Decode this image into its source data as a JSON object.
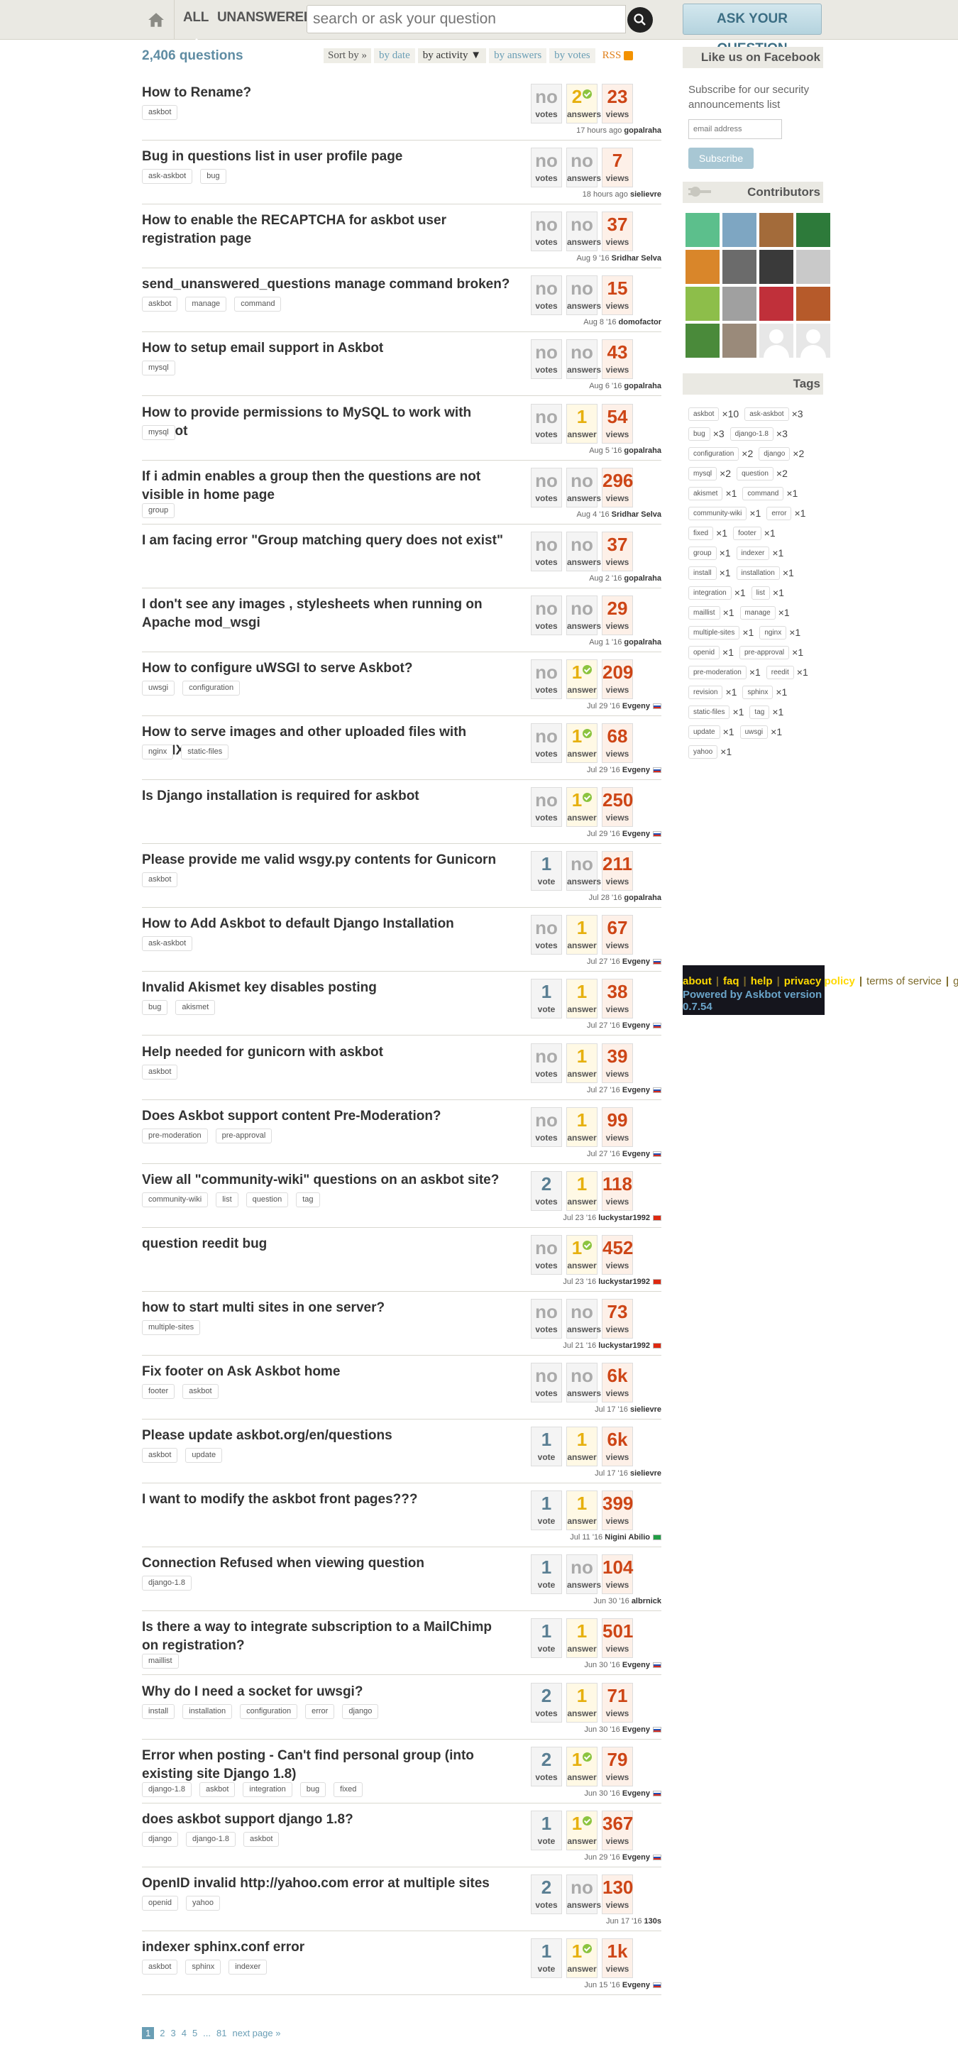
{
  "header": {
    "scope_all": "ALL",
    "scope_unanswered": "UNANSWERED",
    "search_placeholder": "search or ask your question",
    "ask_button": "ASK YOUR QUESTION"
  },
  "main": {
    "question_count": "2,406 questions",
    "sort_label": "Sort by »",
    "sort_tabs": [
      "by date",
      "by activity ▼",
      "by answers",
      "by votes"
    ],
    "rss": "RSS"
  },
  "questions": [
    {
      "title": "How to Rename?",
      "tags": [
        "askbot"
      ],
      "votes": "no",
      "votes_label": "votes",
      "answers": "2",
      "answers_label": "answers",
      "accepted": true,
      "views": "23",
      "views_label": "views",
      "time": "17 hours ago",
      "user": "gopalraha",
      "flag": ""
    },
    {
      "title": "Bug in questions list in user profile page",
      "tags": [
        "ask-askbot",
        "bug"
      ],
      "votes": "no",
      "votes_label": "votes",
      "answers": "no",
      "answers_label": "answers",
      "accepted": false,
      "views": "7",
      "views_label": "views",
      "time": "18 hours ago",
      "user": "sielievre",
      "flag": ""
    },
    {
      "title": "How to enable the RECAPTCHA for askbot user registration page",
      "tags": [],
      "votes": "no",
      "votes_label": "votes",
      "answers": "no",
      "answers_label": "answers",
      "accepted": false,
      "views": "37",
      "views_label": "views",
      "time": "Aug 9 '16",
      "user": "Sridhar Selva",
      "flag": ""
    },
    {
      "title": "send_unanswered_questions manage command broken?",
      "tags": [
        "askbot",
        "manage",
        "command"
      ],
      "votes": "no",
      "votes_label": "votes",
      "answers": "no",
      "answers_label": "answers",
      "accepted": false,
      "views": "15",
      "views_label": "views",
      "time": "Aug 8 '16",
      "user": "domofactor",
      "flag": ""
    },
    {
      "title": "How to setup email support in Askbot",
      "tags": [
        "mysql"
      ],
      "votes": "no",
      "votes_label": "votes",
      "answers": "no",
      "answers_label": "answers",
      "accepted": false,
      "views": "43",
      "views_label": "views",
      "time": "Aug 6 '16",
      "user": "gopalraha",
      "flag": ""
    },
    {
      "title": "How to provide permissions to MySQL to work with Askbot",
      "tags": [
        "mysql"
      ],
      "votes": "no",
      "votes_label": "votes",
      "answers": "1",
      "answers_label": "answer",
      "accepted": false,
      "views": "54",
      "views_label": "views",
      "time": "Aug 5 '16",
      "user": "gopalraha",
      "flag": ""
    },
    {
      "title": "If i admin enables a group then the questions are not visible in home page",
      "tags": [
        "group"
      ],
      "votes": "no",
      "votes_label": "votes",
      "answers": "no",
      "answers_label": "answers",
      "accepted": false,
      "views": "296",
      "views_label": "views",
      "time": "Aug 4 '16",
      "user": "Sridhar Selva",
      "flag": ""
    },
    {
      "title": "I am facing error \"Group matching query does not exist\"",
      "tags": [],
      "votes": "no",
      "votes_label": "votes",
      "answers": "no",
      "answers_label": "answers",
      "accepted": false,
      "views": "37",
      "views_label": "views",
      "time": "Aug 2 '16",
      "user": "gopalraha",
      "flag": ""
    },
    {
      "title": "I don't see any images , stylesheets when running on Apache mod_wsgi",
      "tags": [],
      "votes": "no",
      "votes_label": "votes",
      "answers": "no",
      "answers_label": "answers",
      "accepted": false,
      "views": "29",
      "views_label": "views",
      "time": "Aug 1 '16",
      "user": "gopalraha",
      "flag": ""
    },
    {
      "title": "How to configure uWSGI to serve Askbot?",
      "tags": [
        "uwsgi",
        "configuration"
      ],
      "votes": "no",
      "votes_label": "votes",
      "answers": "1",
      "answers_label": "answer",
      "accepted": true,
      "views": "209",
      "views_label": "views",
      "time": "Jul 29 '16",
      "user": "Evgeny",
      "flag": "ru"
    },
    {
      "title": "How to serve images and other uploaded files with NGINX?",
      "tags": [
        "nginx",
        "static-files"
      ],
      "votes": "no",
      "votes_label": "votes",
      "answers": "1",
      "answers_label": "answer",
      "accepted": true,
      "views": "68",
      "views_label": "views",
      "time": "Jul 29 '16",
      "user": "Evgeny",
      "flag": "ru"
    },
    {
      "title": "Is Django installation is required for askbot",
      "tags": [],
      "votes": "no",
      "votes_label": "votes",
      "answers": "1",
      "answers_label": "answer",
      "accepted": true,
      "views": "250",
      "views_label": "views",
      "time": "Jul 29 '16",
      "user": "Evgeny",
      "flag": "ru"
    },
    {
      "title": "Please provide me valid wsgy.py contents for Gunicorn",
      "tags": [
        "askbot"
      ],
      "votes": "1",
      "votes_label": "vote",
      "answers": "no",
      "answers_label": "answers",
      "accepted": false,
      "views": "211",
      "views_label": "views",
      "time": "Jul 28 '16",
      "user": "gopalraha",
      "flag": ""
    },
    {
      "title": "How to Add Askbot to default Django Installation",
      "tags": [
        "ask-askbot"
      ],
      "votes": "no",
      "votes_label": "votes",
      "answers": "1",
      "answers_label": "answer",
      "accepted": false,
      "views": "67",
      "views_label": "views",
      "time": "Jul 27 '16",
      "user": "Evgeny",
      "flag": "ru"
    },
    {
      "title": "Invalid Akismet key disables posting",
      "tags": [
        "bug",
        "akismet"
      ],
      "votes": "1",
      "votes_label": "vote",
      "answers": "1",
      "answers_label": "answer",
      "accepted": false,
      "views": "38",
      "views_label": "views",
      "time": "Jul 27 '16",
      "user": "Evgeny",
      "flag": "ru"
    },
    {
      "title": "Help needed for gunicorn with askbot",
      "tags": [
        "askbot"
      ],
      "votes": "no",
      "votes_label": "votes",
      "answers": "1",
      "answers_label": "answer",
      "accepted": false,
      "views": "39",
      "views_label": "views",
      "time": "Jul 27 '16",
      "user": "Evgeny",
      "flag": "ru"
    },
    {
      "title": "Does Askbot support content Pre-Moderation?",
      "tags": [
        "pre-moderation",
        "pre-approval"
      ],
      "votes": "no",
      "votes_label": "votes",
      "answers": "1",
      "answers_label": "answer",
      "accepted": false,
      "views": "99",
      "views_label": "views",
      "time": "Jul 27 '16",
      "user": "Evgeny",
      "flag": "ru"
    },
    {
      "title": "View all \"community-wiki\" questions on an askbot site?",
      "tags": [
        "community-wiki",
        "list",
        "question",
        "tag"
      ],
      "votes": "2",
      "votes_label": "votes",
      "answers": "1",
      "answers_label": "answer",
      "accepted": false,
      "views": "118",
      "views_label": "views",
      "time": "Jul 23 '16",
      "user": "luckystar1992",
      "flag": "cn"
    },
    {
      "title": "question reedit bug",
      "tags": [],
      "votes": "no",
      "votes_label": "votes",
      "answers": "1",
      "answers_label": "answer",
      "accepted": true,
      "views": "452",
      "views_label": "views",
      "time": "Jul 23 '16",
      "user": "luckystar1992",
      "flag": "cn"
    },
    {
      "title": "how to start multi sites in one server?",
      "tags": [
        "multiple-sites"
      ],
      "votes": "no",
      "votes_label": "votes",
      "answers": "no",
      "answers_label": "answers",
      "accepted": false,
      "views": "73",
      "views_label": "views",
      "time": "Jul 21 '16",
      "user": "luckystar1992",
      "flag": "cn"
    },
    {
      "title": "Fix footer on Ask Askbot home",
      "tags": [
        "footer",
        "askbot"
      ],
      "votes": "no",
      "votes_label": "votes",
      "answers": "no",
      "answers_label": "answers",
      "accepted": false,
      "views": "6k",
      "views_label": "views",
      "time": "Jul 17 '16",
      "user": "sielievre",
      "flag": ""
    },
    {
      "title": "Please update askbot.org/en/questions",
      "tags": [
        "askbot",
        "update"
      ],
      "votes": "1",
      "votes_label": "vote",
      "answers": "1",
      "answers_label": "answer",
      "accepted": false,
      "views": "6k",
      "views_label": "views",
      "time": "Jul 17 '16",
      "user": "sielievre",
      "flag": ""
    },
    {
      "title": "I want to modify the askbot front pages???",
      "tags": [],
      "votes": "1",
      "votes_label": "vote",
      "answers": "1",
      "answers_label": "answer",
      "accepted": false,
      "views": "399",
      "views_label": "views",
      "time": "Jul 11 '16",
      "user": "Nigini Abilio",
      "flag": "br"
    },
    {
      "title": "Connection Refused when viewing question",
      "tags": [
        "django-1.8"
      ],
      "votes": "1",
      "votes_label": "vote",
      "answers": "no",
      "answers_label": "answers",
      "accepted": false,
      "views": "104",
      "views_label": "views",
      "time": "Jun 30 '16",
      "user": "albrnick",
      "flag": ""
    },
    {
      "title": "Is there a way to integrate subscription to a MailChimp on registration?",
      "tags": [
        "maillist"
      ],
      "votes": "1",
      "votes_label": "vote",
      "answers": "1",
      "answers_label": "answer",
      "accepted": false,
      "views": "501",
      "views_label": "views",
      "time": "Jun 30 '16",
      "user": "Evgeny",
      "flag": "ru"
    },
    {
      "title": "Why do I need a socket for uwsgi?",
      "tags": [
        "install",
        "installation",
        "configuration",
        "error",
        "django"
      ],
      "votes": "2",
      "votes_label": "votes",
      "answers": "1",
      "answers_label": "answer",
      "accepted": false,
      "views": "71",
      "views_label": "views",
      "time": "Jun 30 '16",
      "user": "Evgeny",
      "flag": "ru"
    },
    {
      "title": "Error when posting - Can't find personal group (into existing site Django 1.8)",
      "tags": [
        "django-1.8",
        "askbot",
        "integration",
        "bug",
        "fixed"
      ],
      "votes": "2",
      "votes_label": "votes",
      "answers": "1",
      "answers_label": "answer",
      "accepted": true,
      "views": "79",
      "views_label": "views",
      "time": "Jun 30 '16",
      "user": "Evgeny",
      "flag": "ru"
    },
    {
      "title": "does askbot support django 1.8?",
      "tags": [
        "django",
        "django-1.8",
        "askbot"
      ],
      "votes": "1",
      "votes_label": "vote",
      "answers": "1",
      "answers_label": "answer",
      "accepted": true,
      "views": "367",
      "views_label": "views",
      "time": "Jun 29 '16",
      "user": "Evgeny",
      "flag": "ru"
    },
    {
      "title": "OpenID invalid http://yahoo.com error at multiple sites",
      "tags": [
        "openid",
        "yahoo"
      ],
      "votes": "2",
      "votes_label": "votes",
      "answers": "no",
      "answers_label": "answers",
      "accepted": false,
      "views": "130",
      "views_label": "views",
      "time": "Jun 17 '16",
      "user": "130s",
      "flag": ""
    },
    {
      "title": "indexer sphinx.conf error",
      "tags": [
        "askbot",
        "sphinx",
        "indexer"
      ],
      "votes": "1",
      "votes_label": "vote",
      "answers": "1",
      "answers_label": "answer",
      "accepted": true,
      "views": "1k",
      "views_label": "views",
      "time": "Jun 15 '16",
      "user": "Evgeny",
      "flag": "ru"
    }
  ],
  "paging": {
    "pages": [
      "1",
      "2",
      "3",
      "4",
      "5",
      "...",
      "81"
    ],
    "next": "next page »"
  },
  "sidebar": {
    "facebook_title": "Like us on Facebook",
    "subscribe_text": "Subscribe for our security announcements list",
    "email_placeholder": "email address",
    "subscribe_button": "Subscribe",
    "contributors_title": "Contributors",
    "tags_title": "Tags",
    "tags": [
      {
        "name": "askbot",
        "count": "×10"
      },
      {
        "name": "ask-askbot",
        "count": "×3"
      },
      {
        "name": "bug",
        "count": "×3"
      },
      {
        "name": "django-1.8",
        "count": "×3"
      },
      {
        "name": "configuration",
        "count": "×2"
      },
      {
        "name": "django",
        "count": "×2"
      },
      {
        "name": "mysql",
        "count": "×2"
      },
      {
        "name": "question",
        "count": "×2"
      },
      {
        "name": "akismet",
        "count": "×1"
      },
      {
        "name": "command",
        "count": "×1"
      },
      {
        "name": "community-wiki",
        "count": "×1"
      },
      {
        "name": "error",
        "count": "×1"
      },
      {
        "name": "fixed",
        "count": "×1"
      },
      {
        "name": "footer",
        "count": "×1"
      },
      {
        "name": "group",
        "count": "×1"
      },
      {
        "name": "indexer",
        "count": "×1"
      },
      {
        "name": "install",
        "count": "×1"
      },
      {
        "name": "installation",
        "count": "×1"
      },
      {
        "name": "integration",
        "count": "×1"
      },
      {
        "name": "list",
        "count": "×1"
      },
      {
        "name": "maillist",
        "count": "×1"
      },
      {
        "name": "manage",
        "count": "×1"
      },
      {
        "name": "multiple-sites",
        "count": "×1"
      },
      {
        "name": "nginx",
        "count": "×1"
      },
      {
        "name": "openid",
        "count": "×1"
      },
      {
        "name": "pre-approval",
        "count": "×1"
      },
      {
        "name": "pre-moderation",
        "count": "×1"
      },
      {
        "name": "reedit",
        "count": "×1"
      },
      {
        "name": "revision",
        "count": "×1"
      },
      {
        "name": "sphinx",
        "count": "×1"
      },
      {
        "name": "static-files",
        "count": "×1"
      },
      {
        "name": "tag",
        "count": "×1"
      },
      {
        "name": "update",
        "count": "×1"
      },
      {
        "name": "uwsgi",
        "count": "×1"
      },
      {
        "name": "yahoo",
        "count": "×1"
      }
    ]
  },
  "footer": {
    "links": [
      "about",
      "faq",
      "help",
      "privacy policy",
      "terms of service",
      "give feedback"
    ],
    "powered_by": "Powered by Askbot version 0.7.54"
  }
}
